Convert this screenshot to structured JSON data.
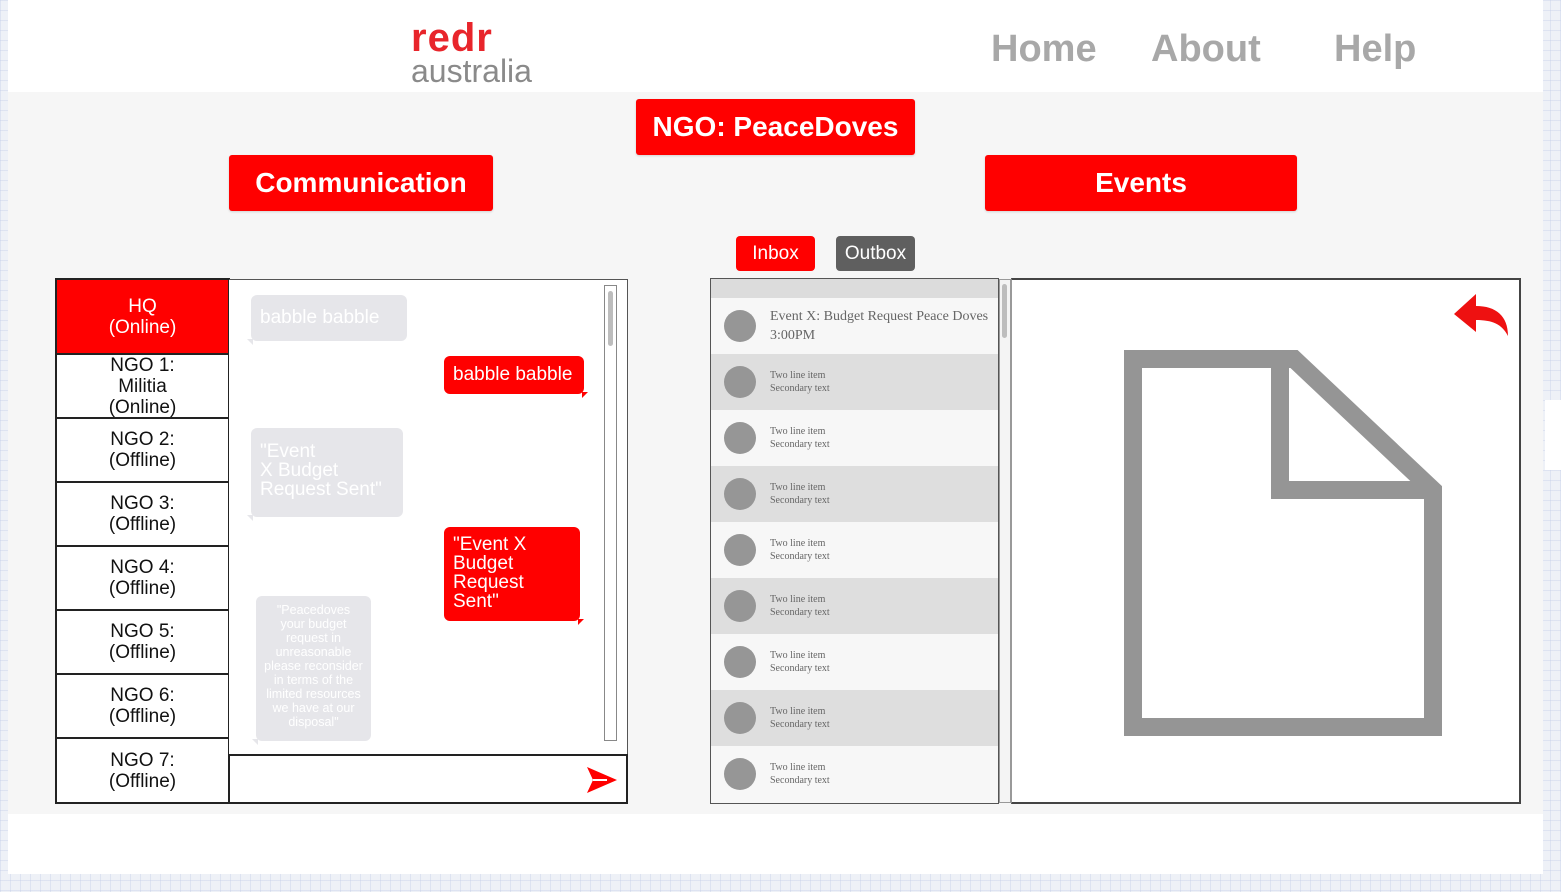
{
  "brand": {
    "line1": "redr",
    "line2": "australia"
  },
  "nav": {
    "home": "Home",
    "about": "About",
    "help": "Help"
  },
  "page_title": "NGO: PeaceDoves",
  "sections": {
    "communication": "Communication",
    "events": "Events"
  },
  "mail_tabs": {
    "inbox": "Inbox",
    "outbox": "Outbox"
  },
  "contacts": [
    {
      "name": "HQ",
      "status": "(Online)",
      "active": true
    },
    {
      "name": "NGO 1:\nMilitia",
      "status": "(Online)"
    },
    {
      "name": "NGO 2:",
      "status": "(Offline)"
    },
    {
      "name": "NGO 3:",
      "status": "(Offline)"
    },
    {
      "name": "NGO 4:",
      "status": "(Offline)"
    },
    {
      "name": "NGO 5:",
      "status": "(Offline)"
    },
    {
      "name": "NGO 6:",
      "status": "(Offline)"
    },
    {
      "name": "NGO 7:",
      "status": "(Offline)"
    }
  ],
  "messages": [
    {
      "from": "them",
      "text": "babble babble"
    },
    {
      "from": "me",
      "text": "babble babble"
    },
    {
      "from": "them",
      "text": "\"Event\nX Budget\nRequest Sent\""
    },
    {
      "from": "me",
      "text": "\"Event X\nBudget\nRequest\nSent\""
    },
    {
      "from": "them",
      "text": "\"Peacedoves\nyour budget\nrequest in\nunreasonable\nplease reconsider\nin terms of the\nlimited resources\nwe have at our\ndisposal\""
    }
  ],
  "events_list": [
    {
      "primary": "Event X: Budget Request Peace Doves",
      "secondary": "3:00PM"
    },
    {
      "primary": "Two line item",
      "secondary": "Secondary text"
    },
    {
      "primary": "Two line item",
      "secondary": "Secondary text"
    },
    {
      "primary": "Two line item",
      "secondary": "Secondary text"
    },
    {
      "primary": "Two line item",
      "secondary": "Secondary text"
    },
    {
      "primary": "Two line item",
      "secondary": "Secondary text"
    },
    {
      "primary": "Two line item",
      "secondary": "Secondary text"
    },
    {
      "primary": "Two line item",
      "secondary": "Secondary text"
    },
    {
      "primary": "Two line item",
      "secondary": "Secondary text"
    }
  ],
  "icons": {
    "send": "send-icon",
    "reply": "reply-icon",
    "document": "document-icon"
  },
  "colors": {
    "accent": "#ff0000",
    "nav_text": "#a8a8a8",
    "logo_red": "#e8252b",
    "outbox_tab": "#5f5f5f",
    "icon_gray": "#999999"
  }
}
